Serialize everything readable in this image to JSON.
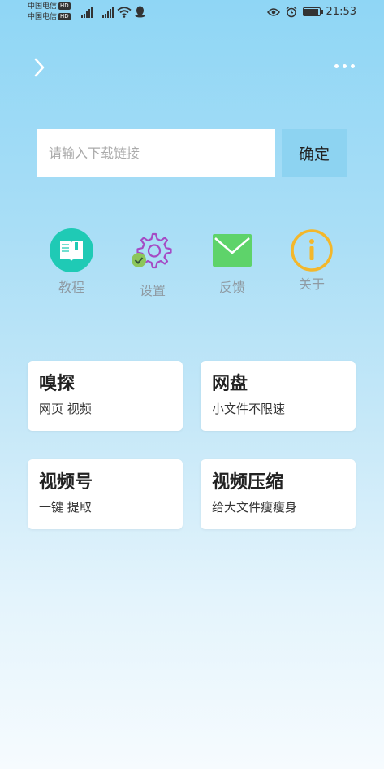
{
  "status": {
    "carrier1": "中国电信",
    "carrier2": "中国电信",
    "hd": "HD",
    "net": "4G",
    "time": "21:53"
  },
  "header": {
    "back_icon": "chevron-right-icon",
    "more_icon": "more-dots-icon"
  },
  "search": {
    "placeholder": "请输入下载链接",
    "value": "",
    "confirm_label": "确定"
  },
  "tools": [
    {
      "label": "教程",
      "icon": "book-icon",
      "color": "#1fcab5"
    },
    {
      "label": "设置",
      "icon": "gear-icon",
      "color": "#b05acb"
    },
    {
      "label": "反馈",
      "icon": "mail-icon",
      "color": "#5ed36a"
    },
    {
      "label": "关于",
      "icon": "info-icon",
      "color": "#f3b72b"
    }
  ],
  "cards": [
    {
      "title": "嗅探",
      "subtitle": "网页 视频"
    },
    {
      "title": "网盘",
      "subtitle": "小文件不限速"
    },
    {
      "title": "视频号",
      "subtitle": "一键 提取"
    },
    {
      "title": "视频压缩",
      "subtitle": "给大文件瘦瘦身"
    }
  ]
}
